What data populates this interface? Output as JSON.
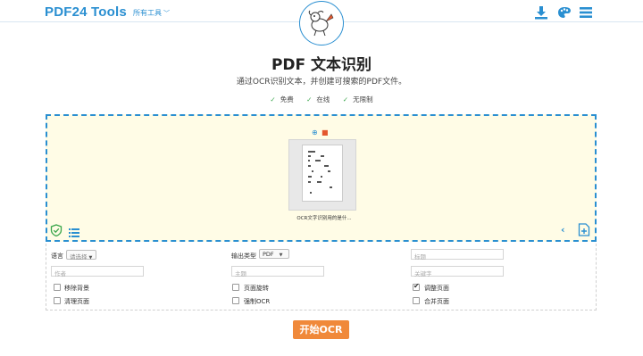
{
  "header": {
    "logo": "PDF24 Tools",
    "all_tools": "所有工具",
    "colors": {
      "brand": "#2a8fd1",
      "accent": "#f0893a"
    },
    "icons": [
      "download-icon",
      "palette-icon",
      "menu-icon"
    ]
  },
  "main": {
    "title": "PDF 文本识别",
    "subtitle": "通过OCR识别文本，并创建可搜索的PDF文件。",
    "features": [
      "免费",
      "在线",
      "无限制"
    ]
  },
  "dropzone": {
    "file": {
      "name": "OCR文字识别用的是什..."
    }
  },
  "options": {
    "language_label": "语言",
    "language_value": "请选择",
    "output_type_label": "输出类型",
    "output_type_value": "PDF",
    "title_placeholder": "标题",
    "author_placeholder": "作者",
    "subject_placeholder": "主题",
    "keywords_placeholder": "关键字",
    "checkboxes": [
      {
        "label": "移除背景",
        "checked": false
      },
      {
        "label": "页面旋转",
        "checked": false
      },
      {
        "label": "调整页面",
        "checked": true
      },
      {
        "label": "清理页面",
        "checked": false
      },
      {
        "label": "强制OCR",
        "checked": false
      },
      {
        "label": "合并页面",
        "checked": false
      }
    ]
  },
  "start_button": "开始OCR"
}
